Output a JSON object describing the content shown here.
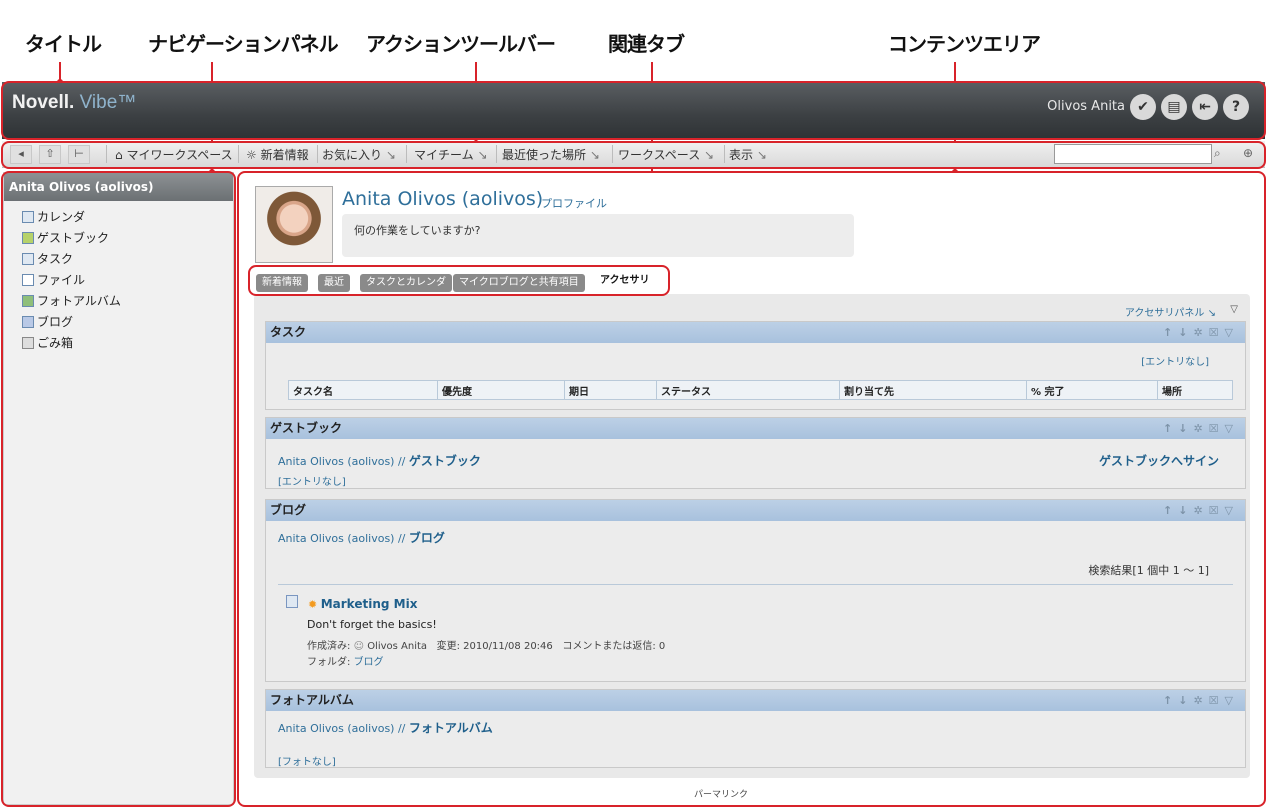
{
  "callouts": {
    "title": "タイトル",
    "navigation": "ナビゲーションパネル",
    "action_toolbar": "アクションツールバー",
    "related_tabs": "関連タブ",
    "content_area": "コンテンツエリア"
  },
  "header": {
    "logo_novell": "Novell.",
    "logo_vibe": "Vibe™",
    "user_name": "Olivos Anita",
    "icons": [
      "personal-prefs-icon",
      "clipboard-icon",
      "logout-icon",
      "help-icon"
    ]
  },
  "toolbar": {
    "buttons": [
      "back-icon",
      "upload-icon",
      "tree-icon"
    ],
    "menus": [
      "マイワークスペース",
      "新着情報",
      "お気に入り",
      "マイチーム",
      "最近使った場所",
      "ワークスペース",
      "表示"
    ],
    "search_placeholder": ""
  },
  "nav": {
    "title": "Anita Olivos (aolivos)",
    "items": [
      "カレンダ",
      "ゲストブック",
      "タスク",
      "ファイル",
      "フォトアルバム",
      "ブログ",
      "ごみ箱"
    ]
  },
  "profile": {
    "name": "Anita Olivos (aolivos)",
    "profile_link": "プロファイル",
    "status_placeholder": "何の作業をしていますか?"
  },
  "tabs": [
    "新着情報",
    "最近",
    "タスクとカレンダ",
    "マイクロブログと共有項目",
    "アクセサリ"
  ],
  "accessory_panel_link": "アクセサリパネル",
  "panels": {
    "tasks": {
      "title": "タスク",
      "no_entries": "[エントリなし]",
      "columns": [
        "タスク名",
        "優先度",
        "期日",
        "ステータス",
        "割り当て先",
        "% 完了",
        "場所"
      ]
    },
    "guestbook": {
      "title": "ゲストブック",
      "owner": "Anita Olivos (aolivos) //",
      "name": "ゲストブック",
      "sign": "ゲストブックへサイン",
      "no_entries": "[エントリなし]"
    },
    "blog": {
      "title": "ブログ",
      "owner": "Anita Olivos (aolivos) //",
      "name": "ブログ",
      "results": "検索結果[1 個中 1 ～ 1]",
      "entry_title": "Marketing Mix",
      "entry_text": "Don't forget the basics!",
      "created_label": "作成済み:",
      "author": "Olivos Anita",
      "modified": "変更: 2010/11/08 20:46",
      "comments": "コメントまたは返信: 0",
      "folder_label": "フォルダ:",
      "folder": "ブログ"
    },
    "photo": {
      "title": "フォトアルバム",
      "owner": "Anita Olivos (aolivos) //",
      "name": "フォトアルバム",
      "no_photos": "[フォトなし]"
    }
  },
  "permalink": "パーマリンク"
}
